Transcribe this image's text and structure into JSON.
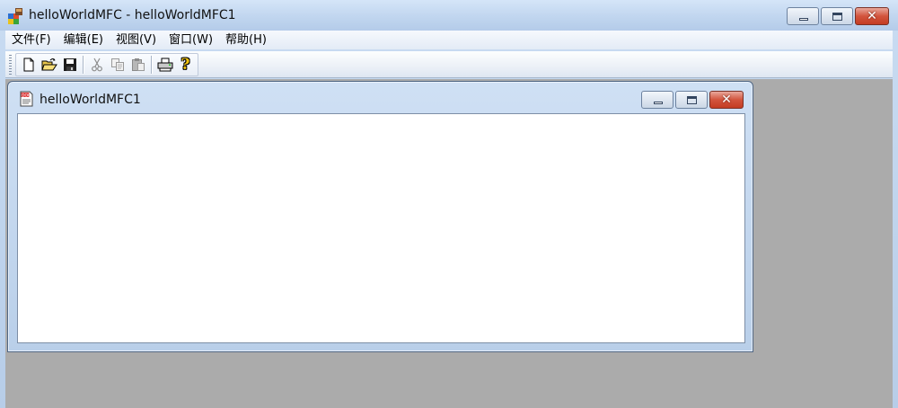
{
  "main_window": {
    "title": "helloWorldMFC - helloWorldMFC1",
    "app_icon": "mfc-app-icon",
    "caption_buttons": [
      {
        "name": "minimize",
        "icon": "minimize-icon"
      },
      {
        "name": "maximize",
        "icon": "maximize-icon"
      },
      {
        "name": "close",
        "icon": "close-icon",
        "glyph": "✕"
      }
    ]
  },
  "menu": {
    "items": [
      {
        "label": "文件(F)"
      },
      {
        "label": "编辑(E)"
      },
      {
        "label": "视图(V)"
      },
      {
        "label": "窗口(W)"
      },
      {
        "label": "帮助(H)"
      }
    ]
  },
  "toolbar": {
    "buttons": [
      {
        "name": "new",
        "icon": "new-document-icon",
        "enabled": true
      },
      {
        "name": "open",
        "icon": "open-folder-icon",
        "enabled": true
      },
      {
        "name": "save",
        "icon": "save-disk-icon",
        "enabled": true
      },
      {
        "name": "cut",
        "icon": "cut-scissors-icon",
        "enabled": false
      },
      {
        "name": "copy",
        "icon": "copy-icon",
        "enabled": false
      },
      {
        "name": "paste",
        "icon": "paste-clipboard-icon",
        "enabled": false
      },
      {
        "name": "print",
        "icon": "printer-icon",
        "enabled": true
      },
      {
        "name": "about",
        "icon": "help-question-icon",
        "enabled": true,
        "glyph": "?"
      }
    ]
  },
  "child_window": {
    "title": "helloWorldMFC1",
    "icon": "document-icon",
    "icon_label": "DOC",
    "close_glyph": "✕"
  },
  "colors": {
    "mdi_background": "#ababab",
    "close_button": "#c43c22",
    "title_gradient_top": "#d5e5f8"
  }
}
